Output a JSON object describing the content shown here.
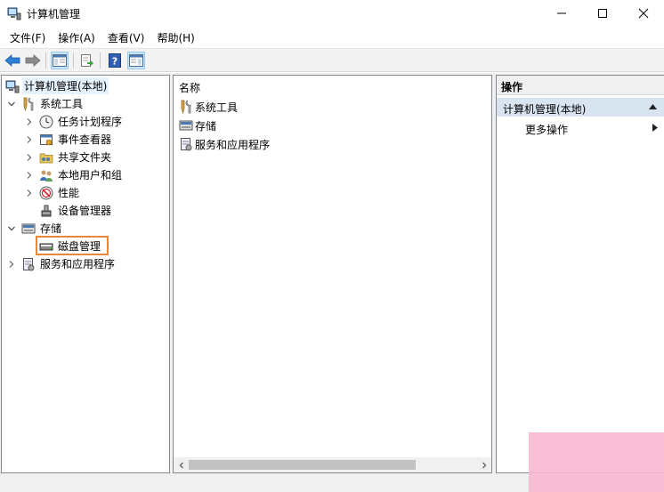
{
  "window": {
    "title": "计算机管理"
  },
  "menu": [
    "文件(F)",
    "操作(A)",
    "查看(V)",
    "帮助(H)"
  ],
  "toolbar": {
    "icons": [
      "back-icon",
      "forward-icon",
      "show-hide-tree-icon",
      "export-list-icon",
      "help-icon",
      "show-hide-action-pane-icon"
    ]
  },
  "tree": {
    "root": "计算机管理(本地)",
    "system_tools": "系统工具",
    "task_scheduler": "任务计划程序",
    "event_viewer": "事件查看器",
    "shared_folders": "共享文件夹",
    "local_users": "本地用户和组",
    "performance": "性能",
    "device_manager": "设备管理器",
    "storage": "存储",
    "disk_management": "磁盘管理",
    "services_apps": "服务和应用程序"
  },
  "list": {
    "header": "名称",
    "items": [
      "系统工具",
      "存储",
      "服务和应用程序"
    ]
  },
  "actions": {
    "header": "操作",
    "section": "计算机管理(本地)",
    "more": "更多操作"
  },
  "colors": {
    "highlight_border": "#e8873a",
    "selection": "#e5f1fb",
    "action_section": "#d9e4f1"
  }
}
